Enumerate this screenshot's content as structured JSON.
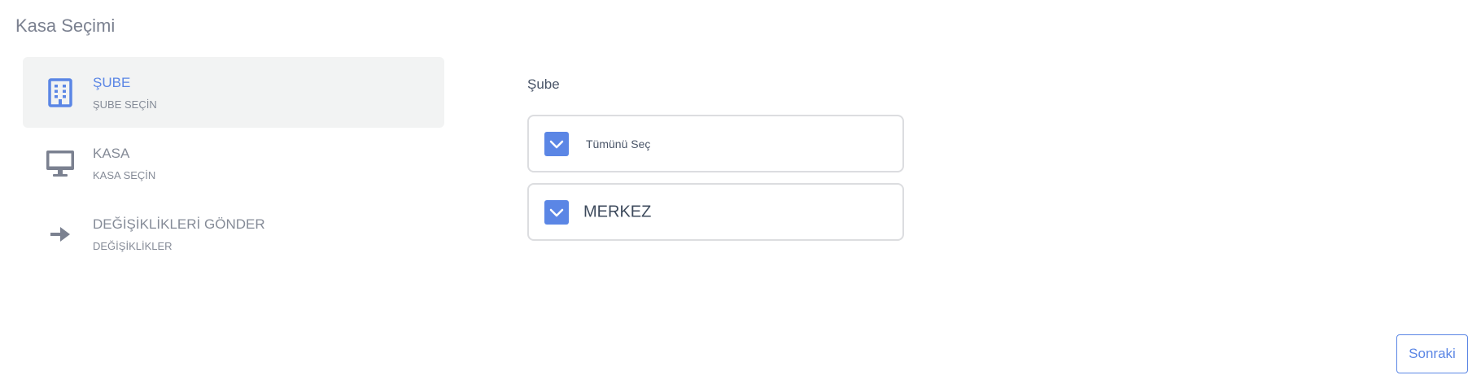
{
  "page": {
    "title": "Kasa Seçimi"
  },
  "steps": [
    {
      "title": "ŞUBE",
      "subtitle": "ŞUBE SEÇİN",
      "icon": "building-icon",
      "active": true
    },
    {
      "title": "KASA",
      "subtitle": "KASA SEÇİN",
      "icon": "monitor-icon",
      "active": false
    },
    {
      "title": "DEĞİŞİKLİKLERİ GÖNDER",
      "subtitle": "DEĞİŞİKLİKLER",
      "icon": "arrow-right-icon",
      "active": false
    }
  ],
  "branch_field": {
    "label": "Şube",
    "options": [
      {
        "label": "Tümünü Seç",
        "checked": true
      },
      {
        "label": "MERKEZ",
        "checked": true
      }
    ]
  },
  "footer": {
    "next_label": "Sonraki"
  },
  "colors": {
    "accent": "#5b86e5",
    "muted": "#858b97",
    "active_bg": "#f2f3f3",
    "border": "#dcdde0"
  }
}
